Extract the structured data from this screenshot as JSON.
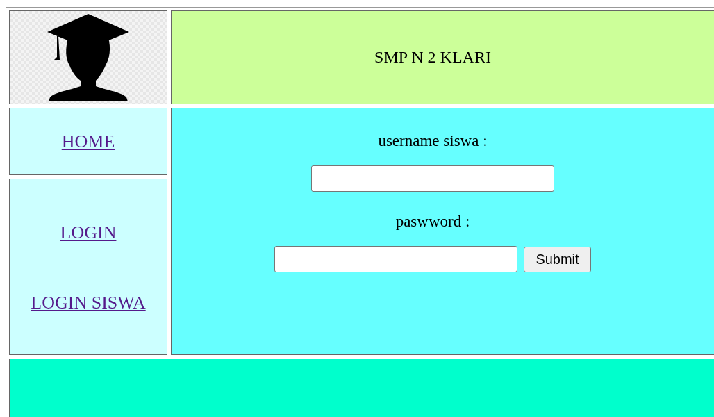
{
  "header": {
    "title": "SMP N 2 KLARI"
  },
  "nav_top": {
    "label": "HOME"
  },
  "nav_login": [
    {
      "label": "LOGIN"
    },
    {
      "label": "LOGIN SISWA"
    }
  ],
  "form": {
    "fields": [
      {
        "label": "username siswa :"
      },
      {
        "label": "paswword :"
      }
    ],
    "submit": "Submit"
  }
}
